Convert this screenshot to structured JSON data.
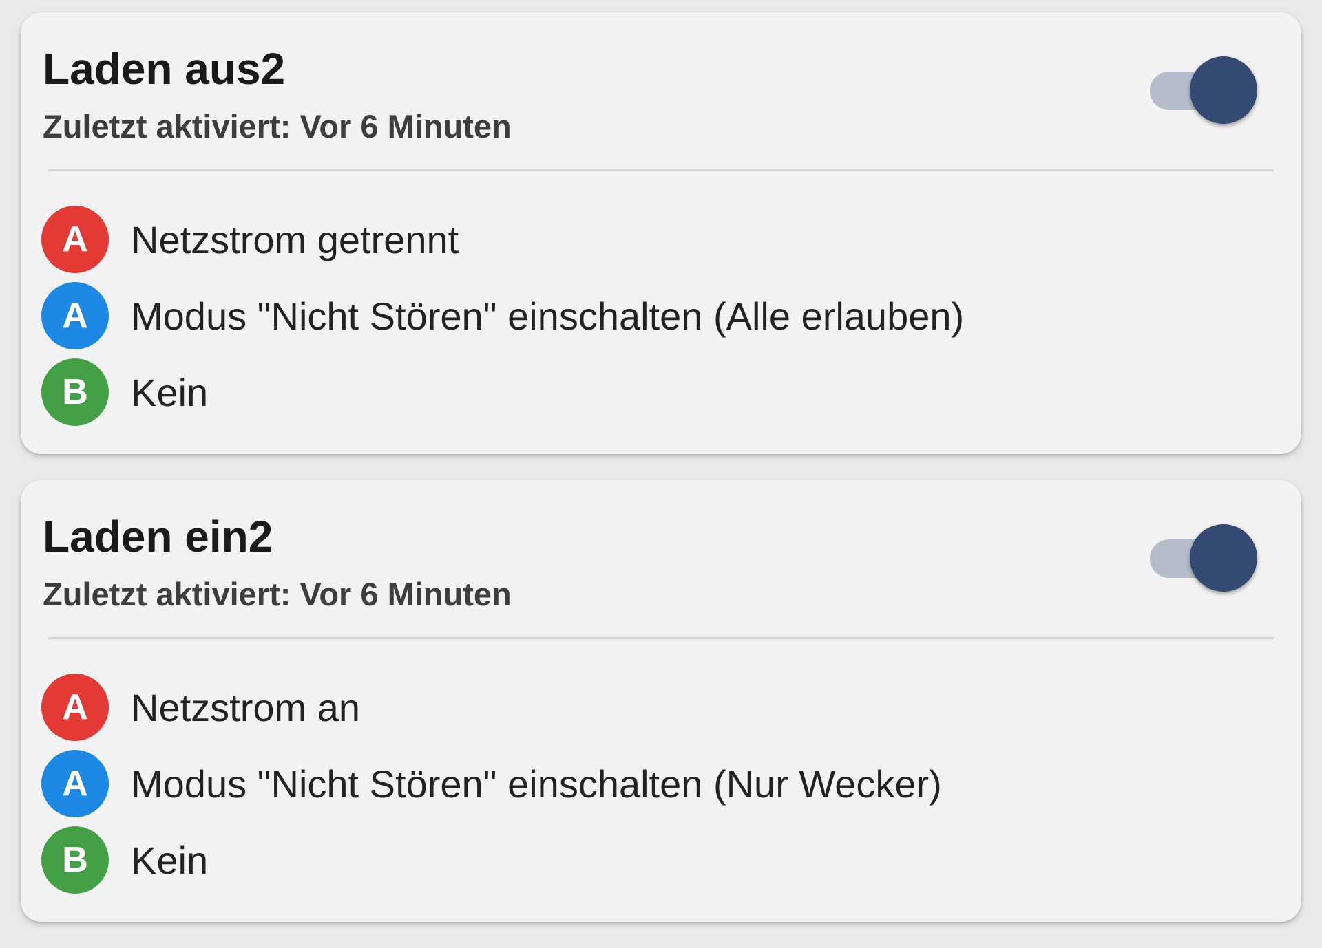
{
  "colors": {
    "trigger_badge": "#e53935",
    "action_badge": "#1e88e5",
    "constraint_badge": "#43a047",
    "toggle_thumb": "#344a72",
    "toggle_track": "#b5bdca",
    "card_background": "#f2f2f2"
  },
  "macros": [
    {
      "title": "Laden aus2",
      "subtitle": "Zuletzt aktiviert: Vor 6 Minuten",
      "enabled": true,
      "trigger": {
        "badge": "A",
        "label": "Netzstrom getrennt"
      },
      "action": {
        "badge": "A",
        "label": "Modus \"Nicht Stören\" einschalten (Alle erlauben)"
      },
      "constraint": {
        "badge": "B",
        "label": "Kein"
      }
    },
    {
      "title": "Laden ein2",
      "subtitle": "Zuletzt aktiviert: Vor 6 Minuten",
      "enabled": true,
      "trigger": {
        "badge": "A",
        "label": "Netzstrom an"
      },
      "action": {
        "badge": "A",
        "label": "Modus \"Nicht Stören\" einschalten (Nur Wecker)"
      },
      "constraint": {
        "badge": "B",
        "label": "Kein"
      }
    }
  ]
}
